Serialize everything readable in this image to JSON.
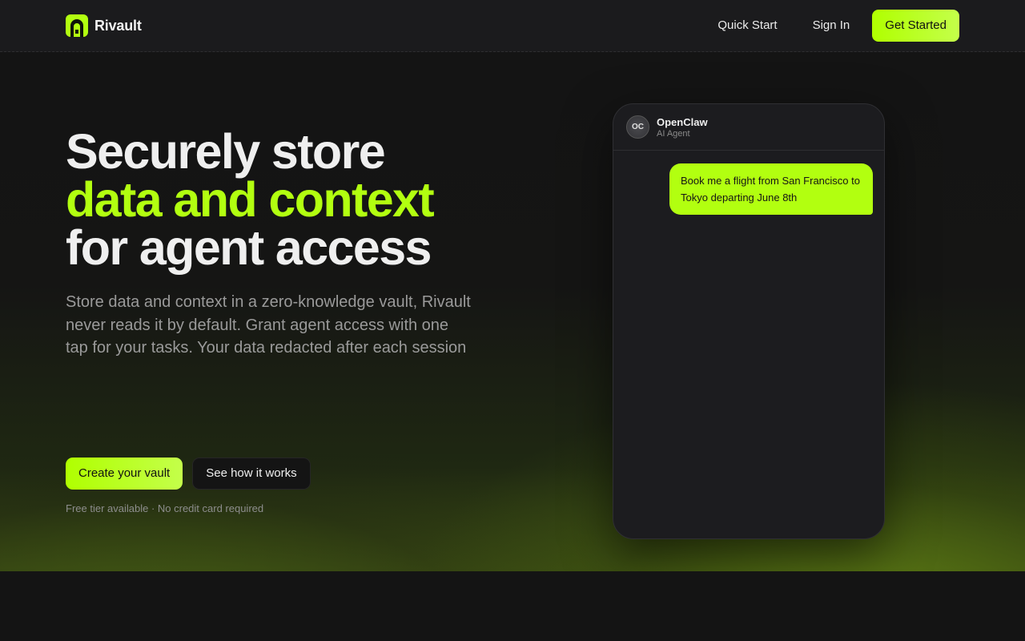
{
  "header": {
    "brand_name": "Rivault",
    "nav": {
      "quick_start": "Quick Start",
      "sign_in": "Sign In",
      "get_started": "Get Started"
    }
  },
  "hero": {
    "headline": {
      "line1": "Securely store",
      "line2": "data and context",
      "line3": "for agent access"
    },
    "subtext": "Store data and context in a zero-knowledge vault, Rivault never reads it by default. Grant agent access with one tap for your tasks. Your data redacted after each session",
    "primary_cta": "Create your vault",
    "secondary_cta": "See how it works",
    "footnote": "Free tier available · No credit card required"
  },
  "chat": {
    "avatar_initials": "OC",
    "agent_name": "OpenClaw",
    "agent_role": "AI Agent",
    "messages": [
      {
        "from": "user",
        "text": "Book me a flight from San Francisco to Tokyo departing June 8th"
      }
    ]
  },
  "colors": {
    "accent": "#b2ff10",
    "background": "#141414",
    "header_bg": "#1b1b1d",
    "muted_text": "#9a9a9a"
  },
  "icons": {
    "logo": "rivault-logo-icon"
  }
}
